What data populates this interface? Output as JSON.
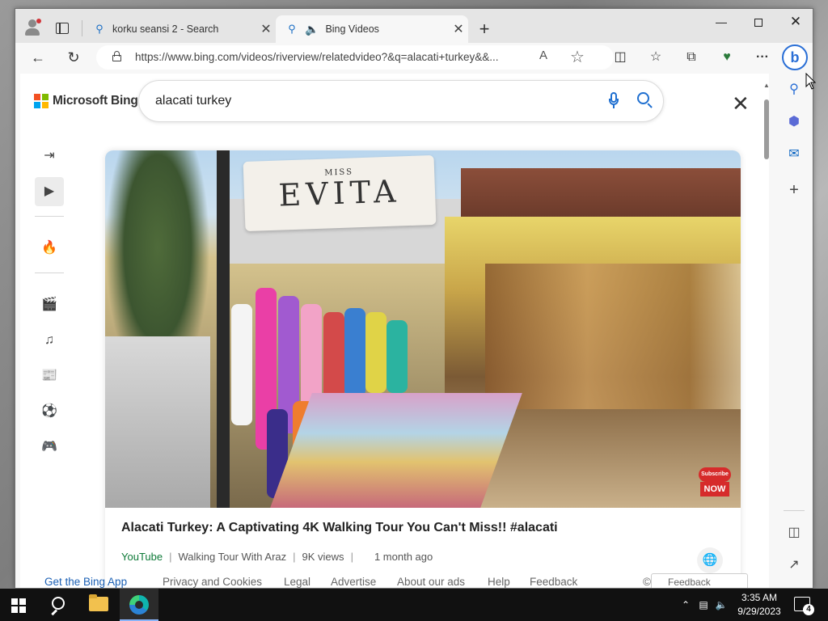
{
  "browser": {
    "tabs": [
      {
        "title": "korku seansi 2 - Search",
        "close": "✕"
      },
      {
        "title": "Bing Videos",
        "close": "✕"
      }
    ],
    "new_tab": "+",
    "window_controls": {
      "minimize": "—",
      "maximize": "",
      "close": "✕"
    },
    "url": "https://www.bing.com/videos/riverview/relatedvideo?&q=alacati+turkey&&...",
    "read_aloud": "A",
    "favorite_star": "☆",
    "more": "···",
    "copilot": "b"
  },
  "page": {
    "brand": "Microsoft Bing",
    "logo_colors": [
      "#f25022",
      "#7fba00",
      "#00a4ef",
      "#ffb900"
    ],
    "search_query": "alacati turkey",
    "close": "✕"
  },
  "rail": {
    "icons": [
      "sidebar-toggle-icon",
      "video-icon",
      "trending-icon",
      "movie-icon",
      "music-icon",
      "news-icon",
      "sports-icon",
      "gaming-icon"
    ]
  },
  "video": {
    "thumbnail": {
      "sign_top": "MISS",
      "sign_main": "EVITA",
      "badge_line1": "Subscribe",
      "badge_line2": "NOW"
    },
    "title": "Alacati Turkey: A Captivating 4K Walking Tour You Can't Miss!! #alacati",
    "source": "YouTube",
    "channel": "Walking Tour With Araz",
    "views": "9K views",
    "age": "1 month ago",
    "separator": "|"
  },
  "footer": {
    "app": "Get the Bing App",
    "privacy": "Privacy and Cookies",
    "legal": "Legal",
    "advertise": "Advertise",
    "about_ads": "About our ads",
    "help": "Help",
    "feedback": "Feedback",
    "copyright": "©",
    "feedback_pill": "Feedback"
  },
  "edge_sidebar": {
    "add": "+"
  },
  "taskbar": {
    "time": "3:35 AM",
    "date": "9/29/2023",
    "notifications": "4"
  }
}
